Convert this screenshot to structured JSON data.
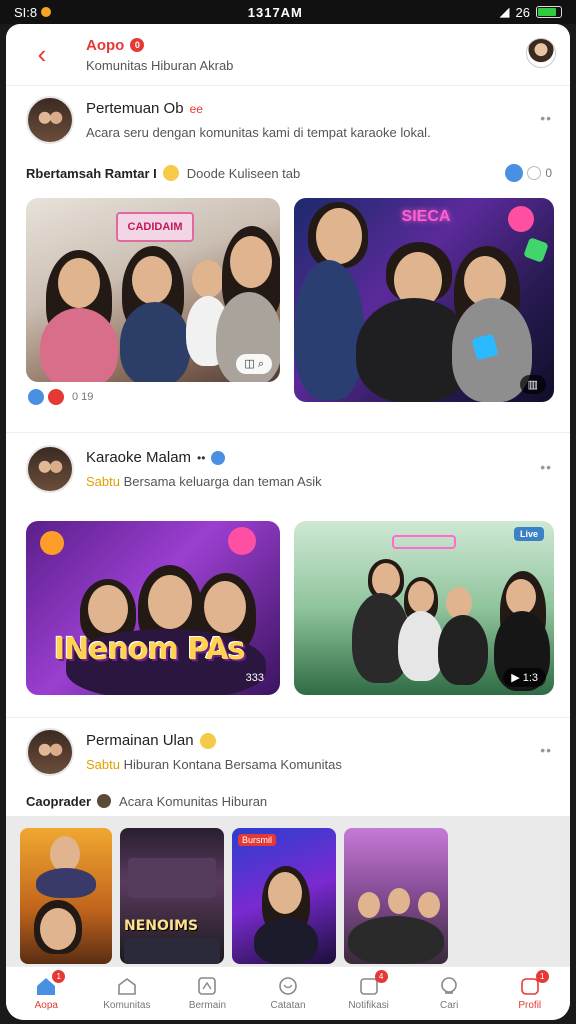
{
  "status_bar": {
    "left_text": "SI:8",
    "time": "1317AM",
    "signal_text": "26"
  },
  "header": {
    "title": "Aopo",
    "badge": "0",
    "subtitle": "Komunitas Hiburan Akrab"
  },
  "post1": {
    "name": "Pertemuan Ob",
    "tag": "ee",
    "description": "Acara seru dengan komunitas kami di tempat karaoke lokal.",
    "more": "••",
    "community_label": "Rbertamsah Ramtar I",
    "community_sub": "Doode Kuliseen tab",
    "react_count": "0",
    "photo1_overlay": "◫ ⌕",
    "photo2_overlay": "▥",
    "sign1": "CADIDAIM",
    "sign2": "SIECA",
    "under_count": "0 19"
  },
  "post2": {
    "name": "Karaoke Malam",
    "tag": "••",
    "subline_prefix": "Sabtu",
    "subline": "Bersama keluarga dan teman Asik",
    "more": "••",
    "photo3_text": "INenom PAs",
    "photo3_overlay": "333",
    "photo4_overlay": "▶ 1:3",
    "photo4_tag": "Live"
  },
  "post3": {
    "name": "Permainan Ulan",
    "subline_prefix": "Sabtu",
    "subline": "Hiburan Kontana Bersama Komunitas",
    "more": "••",
    "community_label": "Caoprader",
    "community_sub": "Acara Komunitas Hiburan"
  },
  "reels": [
    {
      "label": "",
      "tag": ""
    },
    {
      "label": "NENOIMS",
      "tag": ""
    },
    {
      "label": "",
      "tag": "Bursmil"
    },
    {
      "label": "",
      "tag": ""
    }
  ],
  "nav": [
    {
      "label": "Aopa",
      "icon": "home-icon",
      "badge": "1",
      "active": true
    },
    {
      "label": "Komunitas",
      "icon": "community-icon",
      "badge": "",
      "active": false
    },
    {
      "label": "Bermain",
      "icon": "game-icon",
      "badge": "",
      "active": false
    },
    {
      "label": "Catatan",
      "icon": "heart-icon",
      "badge": "",
      "active": false
    },
    {
      "label": "Notifikasi",
      "icon": "bell-icon",
      "badge": "4",
      "active": false
    },
    {
      "label": "Cari",
      "icon": "search-icon",
      "badge": "",
      "active": false
    },
    {
      "label": "Profil",
      "icon": "profile-icon",
      "badge": "1",
      "active": true
    }
  ],
  "colors": {
    "accent": "#e53935",
    "blue": "#4a90e2",
    "yellow": "#e0a100"
  }
}
